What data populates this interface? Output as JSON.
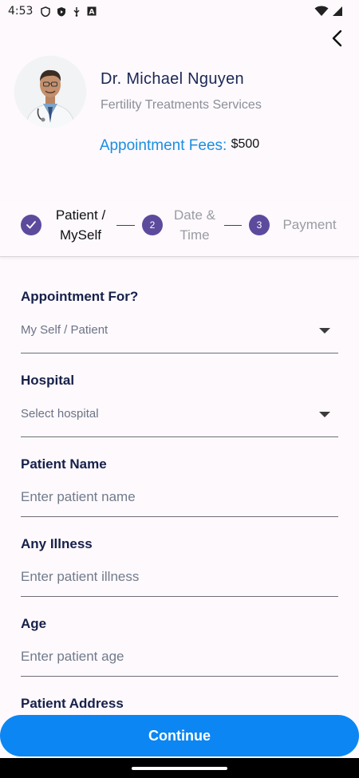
{
  "status_bar": {
    "time": "4:53"
  },
  "doctor": {
    "name": "Dr. Michael Nguyen",
    "specialty": "Fertility Treatments Services"
  },
  "fees": {
    "label": "Appointment Fees:",
    "value": "$500"
  },
  "stepper": {
    "steps": [
      {
        "number": "1",
        "label_line1": "Patient /",
        "label_line2": "MySelf",
        "state": "done"
      },
      {
        "number": "2",
        "label_line1": "Date &",
        "label_line2": "Time",
        "state": "pending"
      },
      {
        "number": "3",
        "label_line1": "Payment",
        "label_line2": "",
        "state": "pending"
      }
    ]
  },
  "form": {
    "appointment_for": {
      "label": "Appointment For?",
      "value": "My Self / Patient"
    },
    "hospital": {
      "label": "Hospital",
      "value": "Select hospital"
    },
    "patient_name": {
      "label": "Patient Name",
      "placeholder": "Enter patient name"
    },
    "illness": {
      "label": "Any Illness",
      "placeholder": "Enter patient illness"
    },
    "age": {
      "label": "Age",
      "placeholder": "Enter patient age"
    },
    "address": {
      "label": "Patient Address"
    }
  },
  "actions": {
    "continue_label": "Continue"
  },
  "colors": {
    "accent": "#0c86f2",
    "step": "#5c4b9d",
    "fees_label": "#1a8fe0"
  },
  "icons": [
    "shield-icon",
    "play-protect-icon",
    "usb-icon",
    "text-icon",
    "wifi-icon",
    "signal-icon",
    "back-arrow-icon",
    "check-icon",
    "dropdown-caret-icon"
  ]
}
